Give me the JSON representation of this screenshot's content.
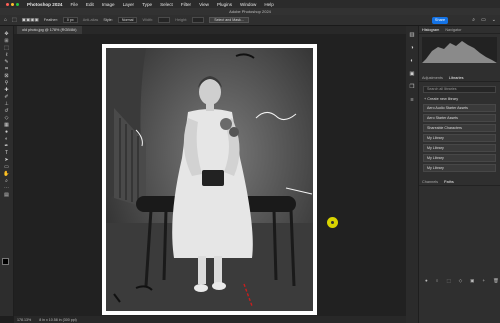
{
  "menubar": {
    "app": "Photoshop 2024",
    "items": [
      "File",
      "Edit",
      "Image",
      "Layer",
      "Type",
      "Select",
      "Filter",
      "View",
      "Plugins",
      "Window",
      "Help"
    ]
  },
  "titlebar": {
    "title": "Adobe Photoshop 2024"
  },
  "options": {
    "feather_label": "Feather:",
    "feather_value": "0 px",
    "antialias_label": "Anti-alias",
    "style_label": "Style:",
    "style_value": "Normal",
    "width_label": "Width:",
    "height_label": "Height:",
    "select_mask_label": "Select and Mask...",
    "share_label": "Share"
  },
  "document": {
    "tab_title": "old photo.jpg @ 178% (RGB/8#)",
    "zoom": "178.13%",
    "dimensions": "8 in x 10.58 in (300 ppi)"
  },
  "colors": {
    "accent": "#1473e6",
    "cursor": "#d9d400",
    "red_mark": "#c81e1e"
  },
  "panel": {
    "top_tabs": [
      "Histogram",
      "Navigator"
    ],
    "mid_tabs": [
      "Adjustments",
      "Libraries"
    ],
    "search_placeholder": "Search all libraries",
    "create_label": "Create new library",
    "libraries": [
      "Aero Audio Starter Assets",
      "Aero Starter Assets",
      "Shareable Characters",
      "My Library",
      "My Library",
      "My Library",
      "My Library"
    ],
    "bottom_tabs": [
      "Channels",
      "Paths"
    ]
  },
  "icons": {
    "tools": [
      "move-icon",
      "artboard-icon",
      "marquee-icon",
      "lasso-icon",
      "quick-select-icon",
      "crop-icon",
      "frame-icon",
      "eyedropper-icon",
      "spot-heal-icon",
      "brush-icon",
      "stamp-icon",
      "history-brush-icon",
      "eraser-icon",
      "gradient-icon",
      "blur-icon",
      "dodge-icon",
      "pen-icon",
      "type-icon",
      "path-select-icon",
      "rectangle-icon",
      "hand-icon",
      "zoom-icon",
      "more-icon"
    ]
  }
}
